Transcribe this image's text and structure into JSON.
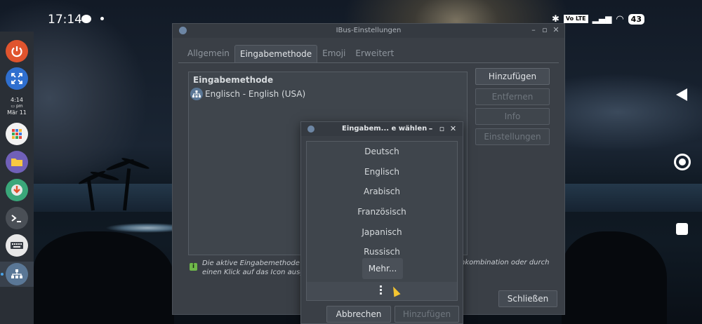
{
  "statusbar": {
    "time": "17:14",
    "volte": "Vo LTE",
    "battery": "43"
  },
  "dock": {
    "clock_time": "4:14",
    "clock_ampm": "pm",
    "clock_date": "Mär 11",
    "items": [
      {
        "name": "power",
        "color": "#e0542e"
      },
      {
        "name": "fullscreen",
        "color": "#2f6fcf"
      },
      {
        "name": "app-grid",
        "color": "#f2f2f2"
      },
      {
        "name": "files",
        "color": "#7060b8"
      },
      {
        "name": "download",
        "color": "#3aa77a"
      },
      {
        "name": "terminal",
        "color": "#4a4f56"
      },
      {
        "name": "keyboard",
        "color": "#e8e8e8"
      },
      {
        "name": "network-settings",
        "color": "#5a7796"
      }
    ]
  },
  "main_window": {
    "title": "IBus-Einstellungen",
    "tabs": [
      "Allgemein",
      "Eingabemethode",
      "Emoji",
      "Erweitert"
    ],
    "active_tab": "Eingabemethode",
    "list_header": "Eingabemethode",
    "list_items": [
      "Englisch - English (USA)"
    ],
    "buttons": {
      "add": "Hinzufügen",
      "remove": "Entfernen",
      "info": "Info",
      "settings": "Einstellungen",
      "close": "Schließen"
    },
    "info_line1": "Die aktive Eingabemethode k",
    "info_line1_right": "nkombination oder durch",
    "info_line2": "einen Klick auf das Icon ausg"
  },
  "dialog": {
    "title": "Eingabem... e wählen",
    "languages": [
      "Deutsch",
      "Englisch",
      "Arabisch",
      "Französisch",
      "Japanisch",
      "Russisch"
    ],
    "more": "Mehr...",
    "cancel": "Abbrechen",
    "add": "Hinzufügen"
  },
  "colors": {
    "window_bg": "#3a3f46",
    "accent_info": "#6fb84a",
    "cursor": "#f4c531"
  }
}
